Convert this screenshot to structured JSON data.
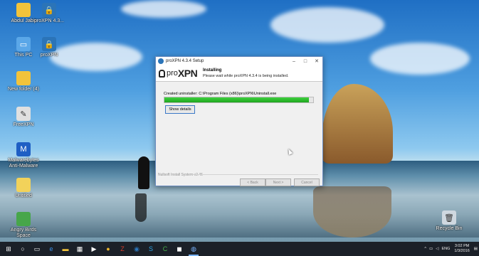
{
  "desktop": {
    "icons": [
      {
        "label": "Abdul Jabir",
        "icon": "user-folder-icon",
        "color": "#f2c33b"
      },
      {
        "label": "proXPN 4.3...",
        "icon": "proxpn-icon",
        "color": "#2b74b8"
      },
      {
        "label": "This PC",
        "icon": "computer-icon",
        "color": "#5aa7e8"
      },
      {
        "label": "proXPN",
        "icon": "proxpn-icon",
        "color": "#2b74b8"
      },
      {
        "label": "New folder (4)",
        "icon": "folder-icon",
        "color": "#f2c33b"
      },
      {
        "label": "FreeXPN",
        "icon": "feather-icon",
        "color": "#e0e0e0"
      },
      {
        "label": "Malwarebytes Anti-Malware",
        "icon": "malwarebytes-icon",
        "color": "#1f5fc4"
      },
      {
        "label": "Untitled",
        "icon": "document-icon",
        "color": "#f2d25a"
      },
      {
        "label": "Angry Birds Space",
        "icon": "game-icon",
        "color": "#47a64a"
      },
      {
        "label": "Recycle Bin",
        "icon": "recycle-bin-icon",
        "color": "#cfd8e0"
      }
    ]
  },
  "window": {
    "title": "proXPN 4.3.4 Setup",
    "controls": {
      "minimize": "–",
      "maximize": "□",
      "close": "✕"
    },
    "logo": {
      "pro": "pro",
      "xpn": "XPN"
    },
    "heading": "Installing",
    "subheading": "Please wait while proXPN 4.3.4 is being installed.",
    "status": "Created uninstaller: C:\\Program Files (x86)\\proXPN\\Uninstall.exe",
    "progress": 0.97,
    "show_details": "Show details",
    "brand": "Nullsoft Install System v2.46",
    "buttons": {
      "back": "< Back",
      "next": "Next >",
      "cancel": "Cancel"
    }
  },
  "taskbar": {
    "items": [
      {
        "name": "start-button",
        "glyph": "⊞",
        "color": "#ffffff"
      },
      {
        "name": "search-icon",
        "glyph": "○",
        "color": "#ffffff"
      },
      {
        "name": "task-view-icon",
        "glyph": "▭",
        "color": "#ffffff"
      },
      {
        "name": "edge-icon",
        "glyph": "e",
        "color": "#3a8ee6"
      },
      {
        "name": "file-explorer-icon",
        "glyph": "▬",
        "color": "#f2c33b"
      },
      {
        "name": "store-icon",
        "glyph": "▦",
        "color": "#ffffff"
      },
      {
        "name": "media-icon",
        "glyph": "▶",
        "color": "#ffffff"
      },
      {
        "name": "chrome-icon",
        "glyph": "●",
        "color": "#e8b32d"
      },
      {
        "name": "filezilla-icon",
        "glyph": "Z",
        "color": "#d53b2b"
      },
      {
        "name": "app-icon",
        "glyph": "◉",
        "color": "#2b74b8"
      },
      {
        "name": "skype-icon",
        "glyph": "S",
        "color": "#2aa3e6"
      },
      {
        "name": "camtasia-icon",
        "glyph": "C",
        "color": "#46b04a"
      },
      {
        "name": "camtasia-recorder-icon",
        "glyph": "◼",
        "color": "#ffffff"
      },
      {
        "name": "proxpn-taskbar-icon",
        "glyph": "◍",
        "color": "#7ab4ff"
      }
    ],
    "tray": {
      "chevron": "^",
      "language": "ENG",
      "time": "3:02 PM",
      "date": "1/3/2016"
    }
  }
}
